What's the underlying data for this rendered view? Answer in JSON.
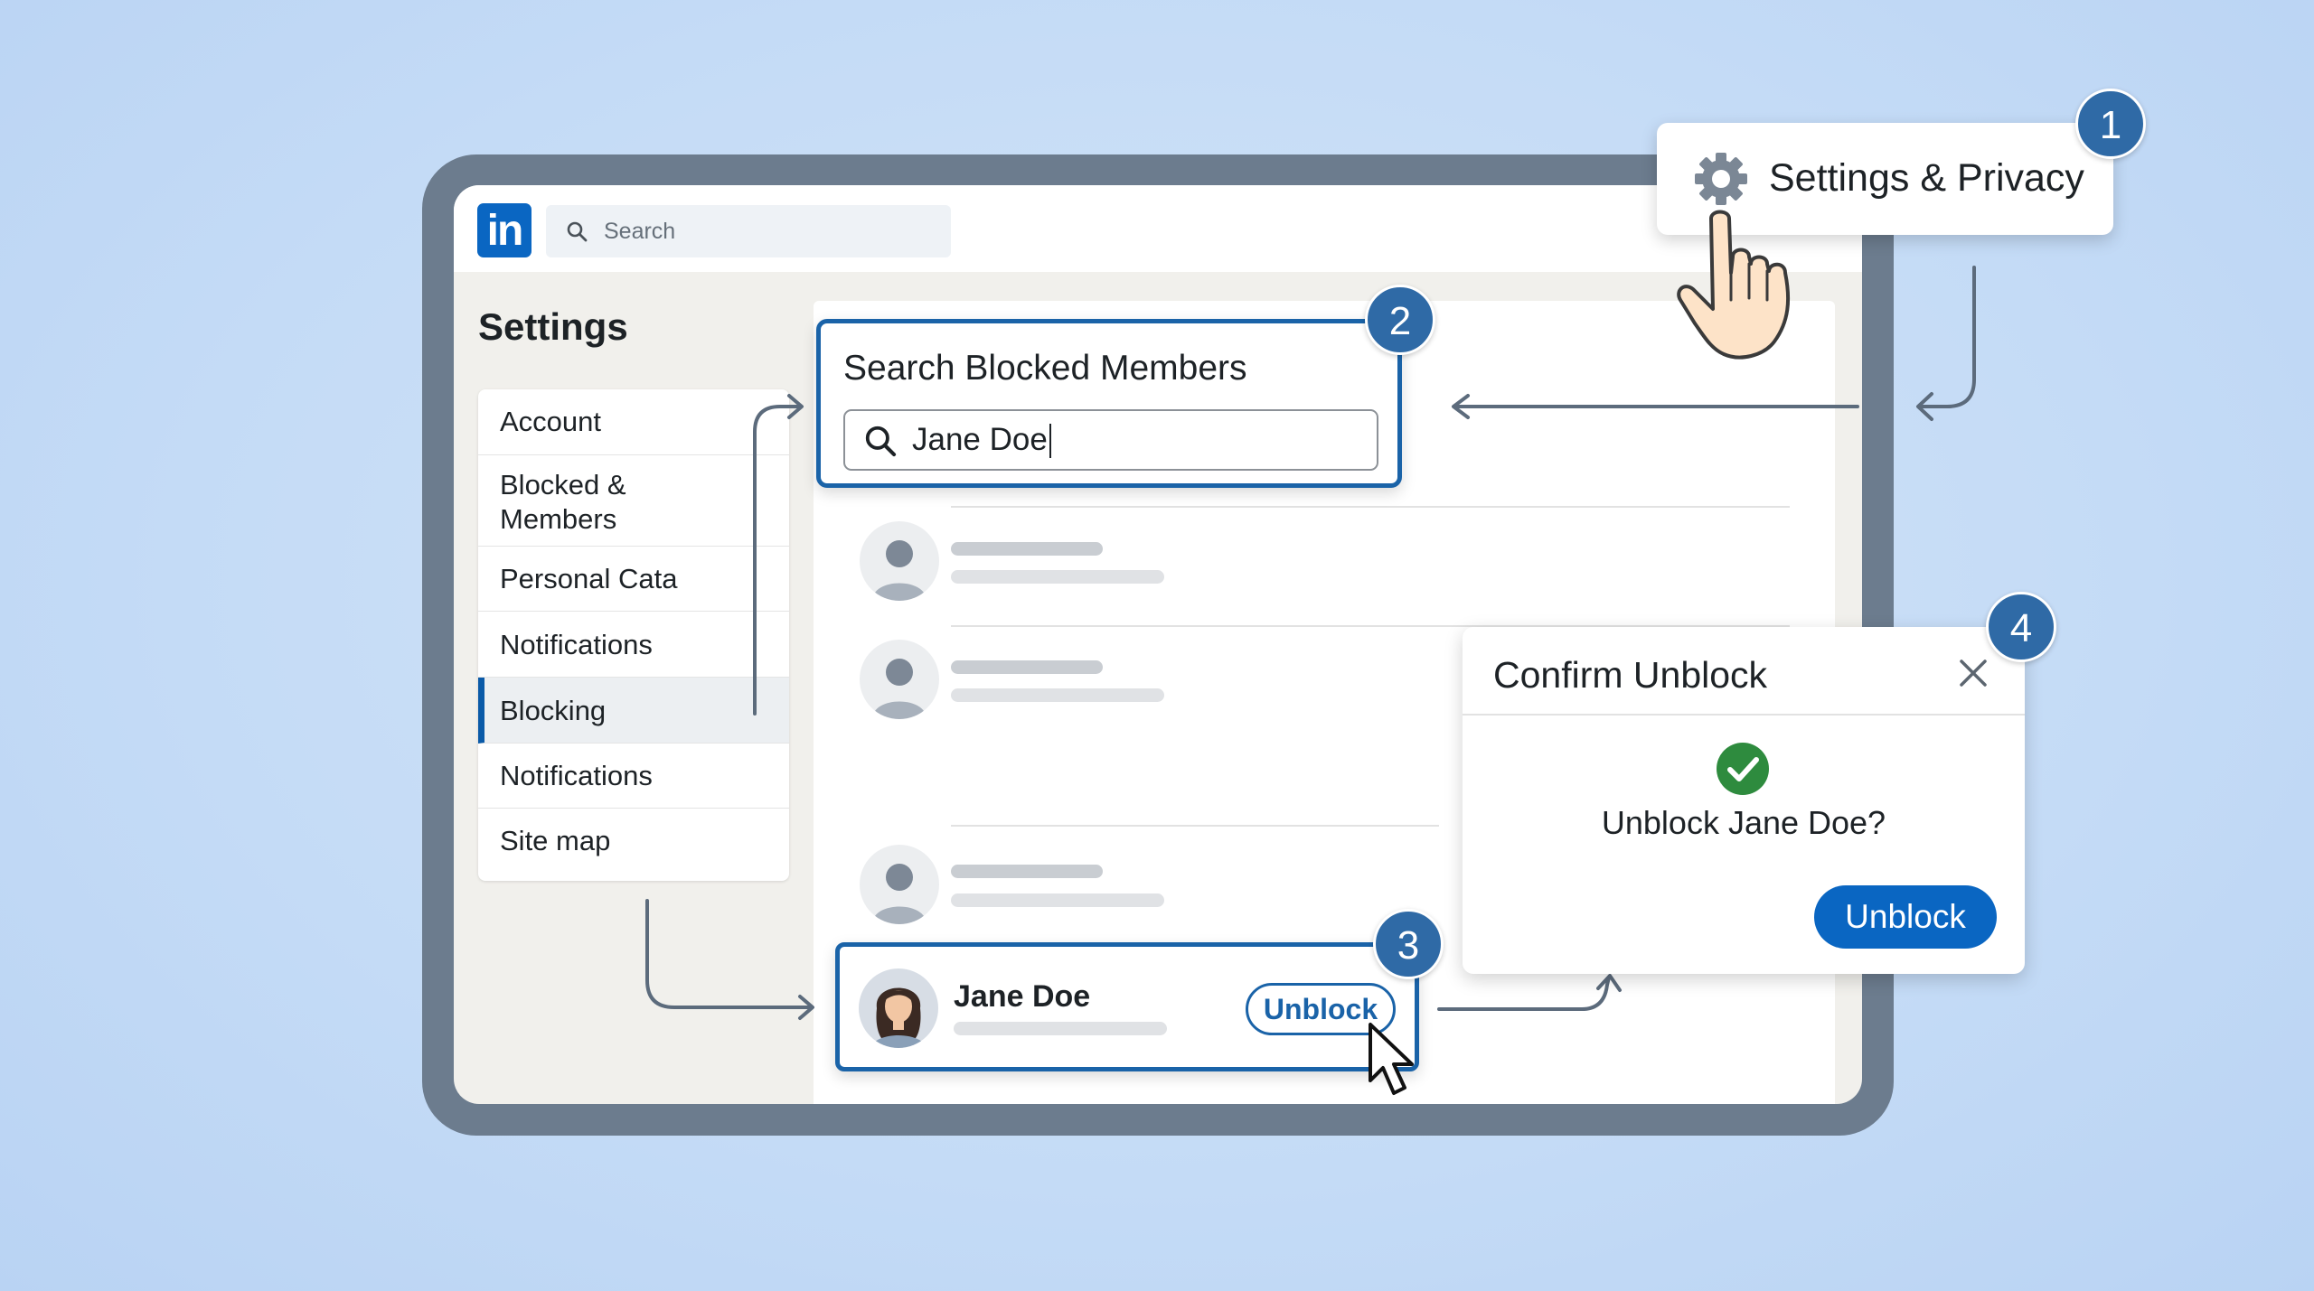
{
  "topbar": {
    "logo_text": "in",
    "search_placeholder": "Search"
  },
  "sidebar": {
    "title": "Settings",
    "items": [
      {
        "label": "Account"
      },
      {
        "label": "Blocked &",
        "label_line2": "Members"
      },
      {
        "label": "Personal Cata"
      },
      {
        "label": "Notifications"
      },
      {
        "label": "Blocking",
        "active": true
      },
      {
        "label": "Notifications"
      },
      {
        "label": "Site map"
      }
    ]
  },
  "steps": {
    "settings_privacy": {
      "badge": "1",
      "label": "Settings & Privacy",
      "icon": "gear-icon"
    },
    "search_blocked": {
      "badge": "2",
      "heading": "Search Blocked Members",
      "input_value": "Jane Doe",
      "icon": "search-icon"
    },
    "blocked_member": {
      "badge": "3",
      "name": "Jane Doe",
      "button_label": "Unblock"
    },
    "confirm": {
      "badge": "4",
      "title": "Confirm Unblock",
      "message": "Unblock Jane Doe?",
      "button_label": "Unblock",
      "close_icon": "close-icon",
      "status_icon": "check-circle-icon"
    }
  },
  "colors": {
    "accent": "#0a66c2",
    "step_border": "#1a63a8",
    "badge": "#2f6aa6",
    "success": "#2e8b3e"
  }
}
